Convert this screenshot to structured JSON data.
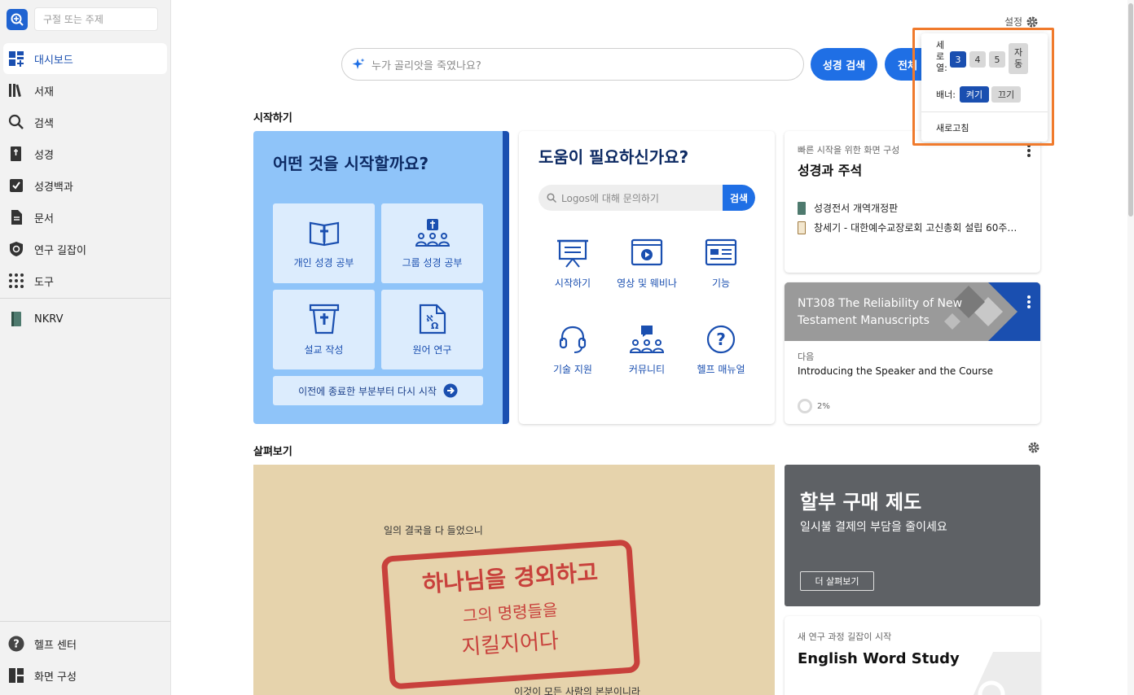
{
  "sidebar": {
    "search_placeholder": "구절 또는 주제",
    "items": [
      {
        "label": "대시보드",
        "icon": "dashboard-icon",
        "active": true
      },
      {
        "label": "서재",
        "icon": "library-icon"
      },
      {
        "label": "검색",
        "icon": "search-icon"
      },
      {
        "label": "성경",
        "icon": "bible-icon"
      },
      {
        "label": "성경백과",
        "icon": "encyclopedia-icon"
      },
      {
        "label": "문서",
        "icon": "document-icon"
      },
      {
        "label": "연구 길잡이",
        "icon": "guide-icon"
      },
      {
        "label": "도구",
        "icon": "grid-icon"
      }
    ],
    "recent": {
      "label": "NKRV",
      "icon": "book-icon"
    },
    "bottom": [
      {
        "label": "헬프 센터",
        "icon": "help-icon"
      },
      {
        "label": "화면 구성",
        "icon": "layout-icon"
      }
    ]
  },
  "header": {
    "settings_label": "설정",
    "search_placeholder": "누가 골리앗을 죽였나요?",
    "bible_search_button": "성경 검색",
    "all_search_button": "전체"
  },
  "start_section": {
    "title": "시작하기",
    "card_title": "어떤 것을 시작할까요?",
    "tiles": [
      {
        "label": "개인 성경 공부",
        "icon": "open-bible-icon"
      },
      {
        "label": "그룹 성경 공부",
        "icon": "group-study-icon"
      },
      {
        "label": "설교 작성",
        "icon": "pulpit-icon"
      },
      {
        "label": "원어 연구",
        "icon": "original-language-icon"
      }
    ],
    "resume_label": "이전에 종료한 부분부터 다시 시작"
  },
  "help_card": {
    "title": "도움이 필요하신가요?",
    "search_placeholder": "Logos에 대해 문의하기",
    "search_button": "검색",
    "items": [
      {
        "label": "시작하기",
        "icon": "presentation-icon"
      },
      {
        "label": "영상 및 웨비나",
        "icon": "video-icon"
      },
      {
        "label": "기능",
        "icon": "features-icon"
      },
      {
        "label": "기술 지원",
        "icon": "headset-icon"
      },
      {
        "label": "커뮤니티",
        "icon": "community-icon"
      },
      {
        "label": "헬프 매뉴얼",
        "icon": "question-icon"
      }
    ]
  },
  "resource_card": {
    "kicker": "빠른 시작을 위한 화면 구성",
    "title": "성경과 주석",
    "items": [
      {
        "label": "성경전서 개역개정판"
      },
      {
        "label": "창세기 - 대한예수교장로회 고신총회 설립 60주…"
      }
    ]
  },
  "course_card": {
    "banner_title": "NT308 The Reliability of New Testament Manuscripts",
    "next_label": "다음",
    "next_title": "Introducing the Speaker and the Course",
    "progress": "2%"
  },
  "browse_section": {
    "title": "살펴보기",
    "poster": {
      "top_line": "일의 결국을 다 들었으니",
      "line1": "하나님을 경외하고",
      "line2": "그의 명령들을",
      "line3": "지킬지어다",
      "bottom_line": "이것이 모든 사람의 본분이니라"
    },
    "promo": {
      "title": "할부 구매 제도",
      "subtitle": "일시불 결제의 부담을 줄이세요",
      "button": "더 살펴보기"
    },
    "course_promo": {
      "kicker": "새 연구 과정 길잡이 시작",
      "title": "English Word Study"
    }
  },
  "settings_menu": {
    "columns_label_lines": [
      "세",
      "로",
      "열:"
    ],
    "column_options": [
      "3",
      "4",
      "5",
      "자\n동"
    ],
    "selected_column": "3",
    "banner_label": "배너:",
    "banner_on": "켜기",
    "banner_off": "끄기",
    "refresh_label": "새로고침"
  },
  "colors": {
    "accent": "#1f6fe5",
    "navy": "#0d2a63",
    "highlight": "#f07a2c"
  }
}
